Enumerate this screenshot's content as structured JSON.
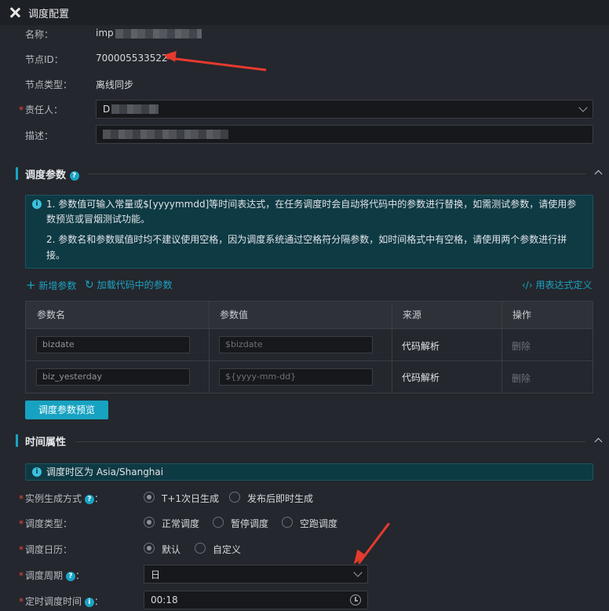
{
  "header": {
    "title": "调度配置"
  },
  "basic": {
    "name_label": "名称：",
    "name_value": "imp",
    "node_id_label": "节点ID：",
    "node_id_value": "700005533522",
    "node_type_label": "节点类型：",
    "node_type_value": "离线同步",
    "owner_label": "责任人：",
    "owner_value": "D",
    "desc_label": "描述：",
    "required_mark": "*"
  },
  "params_section": {
    "title": "调度参数",
    "help_icon": "?",
    "info_icon": "i",
    "info_lines": [
      "1. 参数值可输入常量或$[yyyymmdd]等时间表达式，在任务调度时会自动将代码中的参数进行替换，如需测试参数，请使用参",
      "数预览或冒烟测试功能。",
      "2. 参数名和参数赋值时均不建议使用空格，因为调度系统通过空格符分隔参数，如时间格式中有空格，请使用两个参数进行拼",
      "接。"
    ],
    "add_param": "新增参数",
    "load_params": "加载代码中的参数",
    "expr_define": "用表达式定义",
    "columns": [
      "参数名",
      "参数值",
      "来源",
      "操作"
    ],
    "rows": [
      {
        "name": "bizdate",
        "value": "$bizdate",
        "source": "代码解析",
        "action": "删除"
      },
      {
        "name": "biz_yesterday",
        "value": "${yyyy-mm-dd}",
        "source": "代码解析",
        "action": "删除"
      }
    ],
    "preview_button": "调度参数预览"
  },
  "time_section": {
    "title": "时间属性",
    "timezone": "调度时区为 Asia/Shanghai",
    "instance_label": "实例生成方式",
    "instance_opts": [
      "T+1次日生成",
      "发布后即时生成"
    ],
    "sched_type_label": "调度类型：",
    "sched_type_opts": [
      "正常调度",
      "暂停调度",
      "空跑调度"
    ],
    "calendar_label": "调度日历：",
    "calendar_opts": [
      "默认",
      "自定义"
    ],
    "cycle_label": "调度周期",
    "cycle_value": "日",
    "timer_label": "定时调度时间",
    "timer_value": "00:18",
    "colon": "："
  }
}
